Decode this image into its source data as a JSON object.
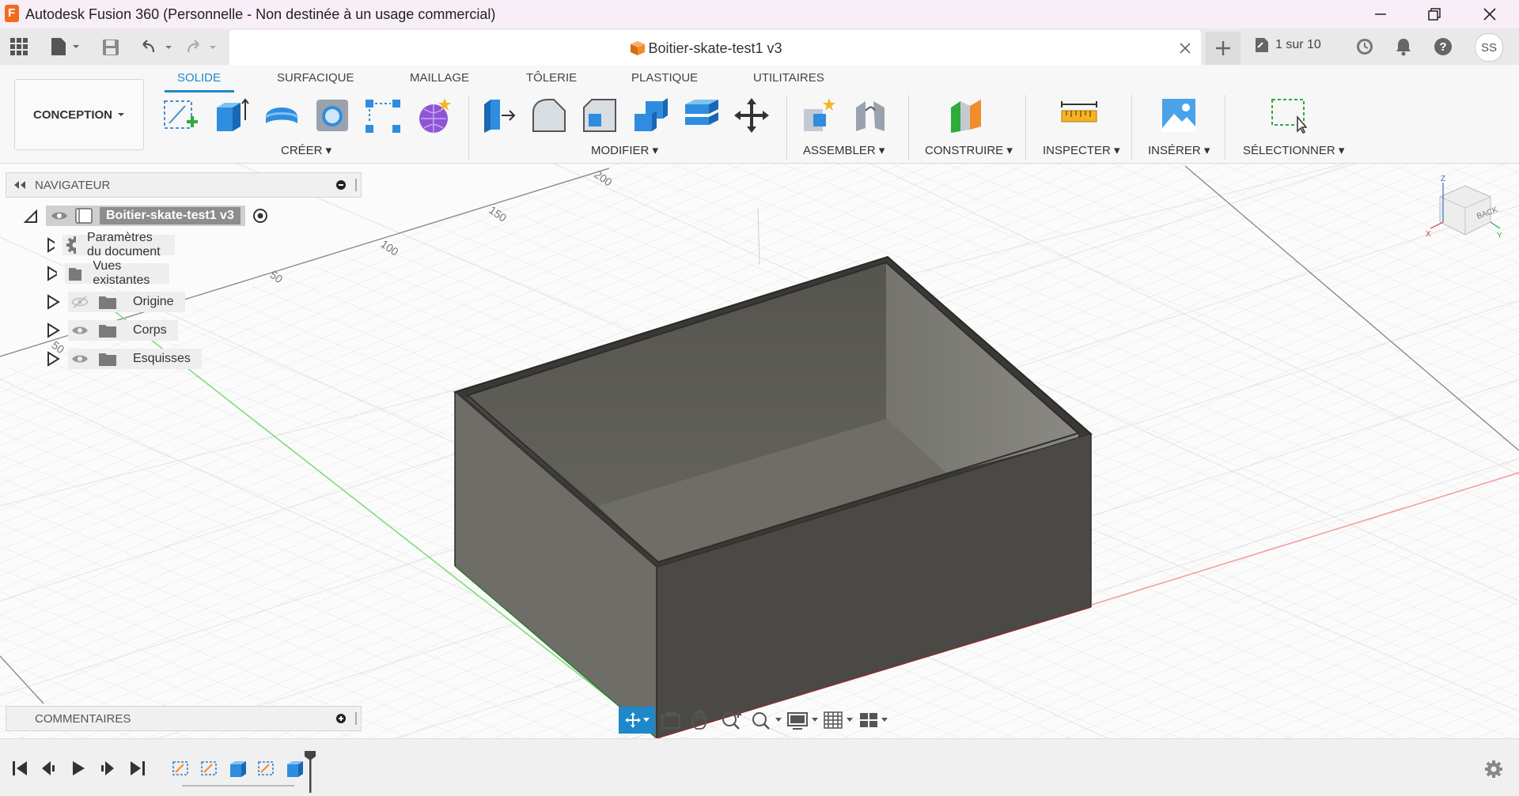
{
  "window": {
    "title": "Autodesk Fusion 360 (Personnelle - Non destinée à un usage commercial)"
  },
  "appbar": {
    "doc_name": "Boitier-skate-test1 v3",
    "jobs_label": "1 sur 10",
    "user_initials": "SS"
  },
  "ribbon": {
    "workspace_label": "CONCEPTION",
    "tabs": [
      "SOLIDE",
      "SURFACIQUE",
      "MAILLAGE",
      "TÔLERIE",
      "PLASTIQUE",
      "UTILITAIRES"
    ],
    "groups": {
      "create": "CRÉER",
      "modify": "MODIFIER",
      "assemble": "ASSEMBLER",
      "construct": "CONSTRUIRE",
      "inspect": "INSPECTER",
      "insert": "INSÉRER",
      "select": "SÉLECTIONNER"
    }
  },
  "navigator": {
    "title": "NAVIGATEUR",
    "root": "Boitier-skate-test1 v3",
    "items": [
      "Paramètres du document",
      "Vues existantes",
      "Origine",
      "Corps",
      "Esquisses"
    ]
  },
  "comments": {
    "title": "COMMENTAIRES"
  },
  "viewport": {
    "ruler_labels": [
      "200",
      "150",
      "100",
      "50",
      "50"
    ],
    "viewcube_face": "BACK",
    "axis_labels": {
      "z": "Z",
      "x": "X",
      "y": "Y"
    }
  },
  "colors": {
    "accent": "#1e88c9",
    "body_dark": "#4a4945",
    "body_mid": "#5c5b56",
    "body_light": "#6e6d67"
  }
}
